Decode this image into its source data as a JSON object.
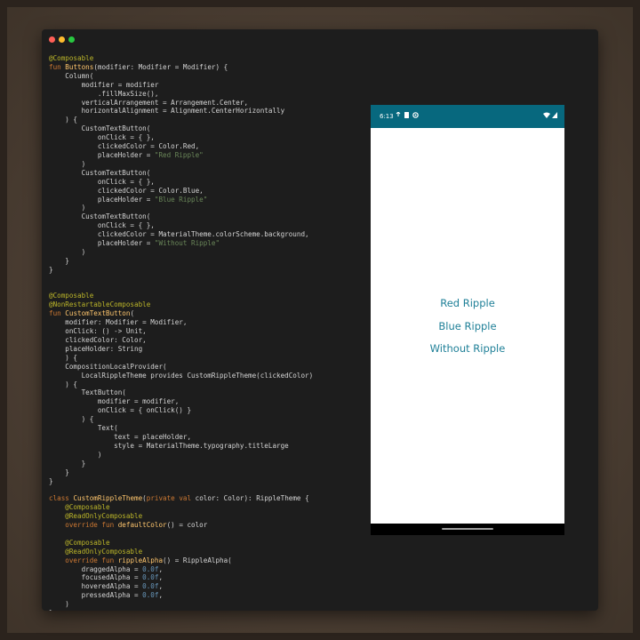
{
  "window": {
    "traffic_lights": [
      "close",
      "minimize",
      "maximize"
    ]
  },
  "code_lines": [
    [
      {
        "t": "@Composable",
        "c": "ann"
      }
    ],
    [
      {
        "t": "fun ",
        "c": "kw"
      },
      {
        "t": "Buttons",
        "c": "fn"
      },
      {
        "t": "(modifier: Modifier = Modifier) {",
        "c": "plain"
      }
    ],
    [
      {
        "t": "    Column(",
        "c": "plain"
      }
    ],
    [
      {
        "t": "        modifier = modifier",
        "c": "plain"
      }
    ],
    [
      {
        "t": "            .fillMaxSize(),",
        "c": "plain"
      }
    ],
    [
      {
        "t": "        verticalArrangement = Arrangement.Center,",
        "c": "plain"
      }
    ],
    [
      {
        "t": "        horizontalAlignment = Alignment.CenterHorizontally",
        "c": "plain"
      }
    ],
    [
      {
        "t": "    ) {",
        "c": "plain"
      }
    ],
    [
      {
        "t": "        CustomTextButton(",
        "c": "plain"
      }
    ],
    [
      {
        "t": "            onClick = { },",
        "c": "plain"
      }
    ],
    [
      {
        "t": "            clickedColor = Color.Red,",
        "c": "plain"
      }
    ],
    [
      {
        "t": "            placeHolder = ",
        "c": "plain"
      },
      {
        "t": "\"Red Ripple\"",
        "c": "str"
      }
    ],
    [
      {
        "t": "        )",
        "c": "plain"
      }
    ],
    [
      {
        "t": "        CustomTextButton(",
        "c": "plain"
      }
    ],
    [
      {
        "t": "            onClick = { },",
        "c": "plain"
      }
    ],
    [
      {
        "t": "            clickedColor = Color.Blue,",
        "c": "plain"
      }
    ],
    [
      {
        "t": "            placeHolder = ",
        "c": "plain"
      },
      {
        "t": "\"Blue Ripple\"",
        "c": "str"
      }
    ],
    [
      {
        "t": "        )",
        "c": "plain"
      }
    ],
    [
      {
        "t": "        CustomTextButton(",
        "c": "plain"
      }
    ],
    [
      {
        "t": "            onClick = { },",
        "c": "plain"
      }
    ],
    [
      {
        "t": "            clickedColor = MaterialTheme.colorScheme.background,",
        "c": "plain"
      }
    ],
    [
      {
        "t": "            placeHolder = ",
        "c": "plain"
      },
      {
        "t": "\"Without Ripple\"",
        "c": "str"
      }
    ],
    [
      {
        "t": "        )",
        "c": "plain"
      }
    ],
    [
      {
        "t": "    }",
        "c": "plain"
      }
    ],
    [
      {
        "t": "}",
        "c": "plain"
      }
    ],
    [
      {
        "t": "",
        "c": "plain"
      }
    ],
    [
      {
        "t": "",
        "c": "plain"
      }
    ],
    [
      {
        "t": "@Composable",
        "c": "ann"
      }
    ],
    [
      {
        "t": "@NonRestartableComposable",
        "c": "ann"
      }
    ],
    [
      {
        "t": "fun ",
        "c": "kw"
      },
      {
        "t": "CustomTextButton",
        "c": "fn"
      },
      {
        "t": "(",
        "c": "plain"
      }
    ],
    [
      {
        "t": "    modifier: Modifier = Modifier,",
        "c": "plain"
      }
    ],
    [
      {
        "t": "    onClick: () -> Unit,",
        "c": "plain"
      }
    ],
    [
      {
        "t": "    clickedColor: Color,",
        "c": "plain"
      }
    ],
    [
      {
        "t": "    placeHolder: String",
        "c": "plain"
      }
    ],
    [
      {
        "t": "    ) {",
        "c": "plain"
      }
    ],
    [
      {
        "t": "    CompositionLocalProvider(",
        "c": "plain"
      }
    ],
    [
      {
        "t": "        LocalRippleTheme provides CustomRippleTheme(clickedColor)",
        "c": "plain"
      }
    ],
    [
      {
        "t": "    ) {",
        "c": "plain"
      }
    ],
    [
      {
        "t": "        TextButton(",
        "c": "plain"
      }
    ],
    [
      {
        "t": "            modifier = modifier,",
        "c": "plain"
      }
    ],
    [
      {
        "t": "            onClick = { onClick() }",
        "c": "plain"
      }
    ],
    [
      {
        "t": "        ) {",
        "c": "plain"
      }
    ],
    [
      {
        "t": "            Text(",
        "c": "plain"
      }
    ],
    [
      {
        "t": "                text = placeHolder,",
        "c": "plain"
      }
    ],
    [
      {
        "t": "                style = MaterialTheme.typography.titleLarge",
        "c": "plain"
      }
    ],
    [
      {
        "t": "            )",
        "c": "plain"
      }
    ],
    [
      {
        "t": "        }",
        "c": "plain"
      }
    ],
    [
      {
        "t": "    }",
        "c": "plain"
      }
    ],
    [
      {
        "t": "}",
        "c": "plain"
      }
    ],
    [
      {
        "t": "",
        "c": "plain"
      }
    ],
    [
      {
        "t": "class ",
        "c": "kw"
      },
      {
        "t": "CustomRippleTheme",
        "c": "fn"
      },
      {
        "t": "(",
        "c": "plain"
      },
      {
        "t": "private val ",
        "c": "kw"
      },
      {
        "t": "color: Color): RippleTheme {",
        "c": "plain"
      }
    ],
    [
      {
        "t": "    @Composable",
        "c": "ann"
      }
    ],
    [
      {
        "t": "    @ReadOnlyComposable",
        "c": "ann"
      }
    ],
    [
      {
        "t": "    override fun ",
        "c": "kw"
      },
      {
        "t": "defaultColor",
        "c": "fn"
      },
      {
        "t": "() = color",
        "c": "plain"
      }
    ],
    [
      {
        "t": "",
        "c": "plain"
      }
    ],
    [
      {
        "t": "    @Composable",
        "c": "ann"
      }
    ],
    [
      {
        "t": "    @ReadOnlyComposable",
        "c": "ann"
      }
    ],
    [
      {
        "t": "    override fun ",
        "c": "kw"
      },
      {
        "t": "rippleAlpha",
        "c": "fn"
      },
      {
        "t": "() = RippleAlpha(",
        "c": "plain"
      }
    ],
    [
      {
        "t": "        draggedAlpha = ",
        "c": "plain"
      },
      {
        "t": "0.0f",
        "c": "num"
      },
      {
        "t": ",",
        "c": "plain"
      }
    ],
    [
      {
        "t": "        focusedAlpha = ",
        "c": "plain"
      },
      {
        "t": "0.0f",
        "c": "num"
      },
      {
        "t": ",",
        "c": "plain"
      }
    ],
    [
      {
        "t": "        hoveredAlpha = ",
        "c": "plain"
      },
      {
        "t": "0.0f",
        "c": "num"
      },
      {
        "t": ",",
        "c": "plain"
      }
    ],
    [
      {
        "t": "        pressedAlpha = ",
        "c": "plain"
      },
      {
        "t": "0.0f",
        "c": "num"
      },
      {
        "t": ",",
        "c": "plain"
      }
    ],
    [
      {
        "t": "    )",
        "c": "plain"
      }
    ],
    [
      {
        "t": "}",
        "c": "plain"
      }
    ]
  ],
  "phone": {
    "status_time": "6:13",
    "status_icons_left": [
      "notification-icon",
      "sim-icon",
      "sync-icon"
    ],
    "status_icons_right": [
      "wifi-icon",
      "signal-icon"
    ],
    "statusbar_color": "#07687e",
    "buttons": {
      "red": "Red Ripple",
      "blue": "Blue Ripple",
      "none": "Without Ripple"
    },
    "button_text_color": "#1e7f97"
  }
}
